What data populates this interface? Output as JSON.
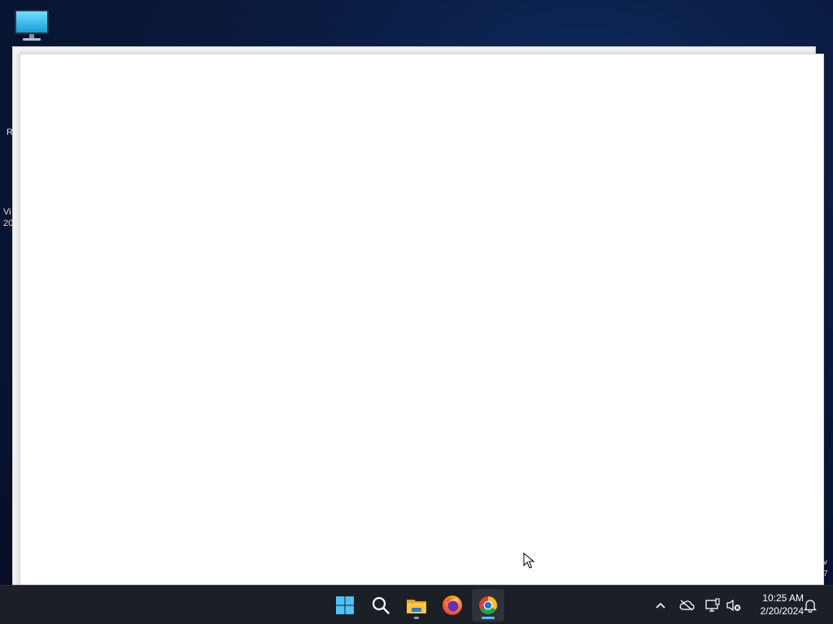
{
  "desktop": {
    "icons": [
      {
        "name": "This PC",
        "icon": "monitor-icon"
      }
    ],
    "edge_fragments": {
      "left_upper": "R",
      "left_lower": "Vi\n20",
      "right_bottom": "v\n7"
    }
  },
  "windows": {
    "back_window": {
      "content": ""
    },
    "front_window": {
      "content": ""
    }
  },
  "taskbar": {
    "apps": [
      {
        "name": "Start",
        "icon": "windows-logo-icon"
      },
      {
        "name": "Search",
        "icon": "search-icon"
      },
      {
        "name": "File Explorer",
        "icon": "folder-icon",
        "running": true
      },
      {
        "name": "Firefox",
        "icon": "firefox-icon"
      },
      {
        "name": "Google Chrome",
        "icon": "chrome-icon",
        "running": true,
        "active": true
      }
    ],
    "tray": {
      "icons": [
        "chevron-up-icon",
        "onedrive-offline-icon",
        "network-icon",
        "volume-muted-icon",
        "notification-bell-icon"
      ],
      "time": "10:25 AM",
      "date": "2/20/2024"
    }
  },
  "colors": {
    "desktop_bg": "#0a1a3d",
    "taskbar_bg": "#1c1f26",
    "accent": "#4cc2ff"
  }
}
